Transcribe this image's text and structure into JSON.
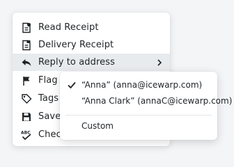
{
  "menu": {
    "items": [
      {
        "label": "Read Receipt",
        "icon": "read-receipt-icon"
      },
      {
        "label": "Delivery Receipt",
        "icon": "delivery-receipt-icon"
      },
      {
        "label": "Reply to address",
        "icon": "reply-icon"
      },
      {
        "label": "Flag",
        "icon": "flag-icon"
      },
      {
        "label": "Tags",
        "icon": "tag-icon"
      },
      {
        "label": "Save",
        "icon": "save-icon"
      },
      {
        "label": "Check spelling...",
        "icon": "spellcheck-icon"
      }
    ],
    "active_item": "Reply to address"
  },
  "submenu": {
    "items": [
      {
        "label": "“Anna” (anna@icewarp.com)",
        "checked": true
      },
      {
        "label": "“Anna Clark” (annaC@icewarp.com)",
        "checked": false
      },
      {
        "label": "Custom",
        "checked": false
      }
    ]
  },
  "colors": {
    "text": "#1f2326",
    "active_background": "#e8ebee",
    "icon": "#1f2326"
  }
}
